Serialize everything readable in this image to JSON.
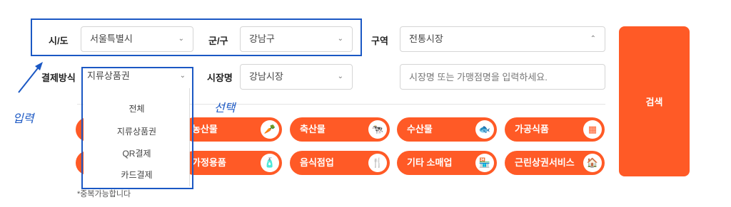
{
  "filters": {
    "sido": {
      "label": "시/도",
      "value": "서울특별시"
    },
    "gungu": {
      "label": "군/구",
      "value": "강남구"
    },
    "district": {
      "label": "구역",
      "value": "전통시장"
    },
    "payment": {
      "label": "결제방식",
      "value": "지류상품권"
    },
    "market": {
      "label": "시장명",
      "value": "강남시장"
    },
    "keyword": {
      "placeholder": "시장명 또는 가맹점명을 입력하세요."
    }
  },
  "dropdown_options": [
    "전체",
    "지류상품권",
    "QR결제",
    "카드결제"
  ],
  "categories": [
    {
      "label": "농산물",
      "icon": "produce-icon",
      "glyph": "🥕"
    },
    {
      "label": "축산물",
      "icon": "cow-icon",
      "glyph": "🐄"
    },
    {
      "label": "수산물",
      "icon": "fish-icon",
      "glyph": "🐟"
    },
    {
      "label": "가공식품",
      "icon": "box-icon",
      "glyph": "▦"
    },
    {
      "label": "가정용품",
      "icon": "bottles-icon",
      "glyph": "🧴"
    },
    {
      "label": "음식점업",
      "icon": "utensils-icon",
      "glyph": "🍴"
    },
    {
      "label": "기타 소매업",
      "icon": "store-icon",
      "glyph": "🏪"
    },
    {
      "label": "근린상권서비스",
      "icon": "house-icon",
      "glyph": "🏠"
    }
  ],
  "search_label": "검색",
  "note": "*중복가능합니다",
  "annotations": {
    "input": "입력",
    "select": "선택"
  },
  "colors": {
    "accent": "#ff5a26",
    "annotation": "#1b58c4"
  }
}
